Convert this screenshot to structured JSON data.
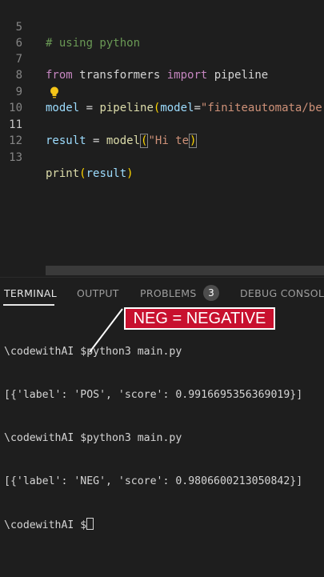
{
  "editor": {
    "lines": [
      {
        "num": "5",
        "comment": "# using python"
      },
      {
        "num": "6"
      },
      {
        "num": "7",
        "kw1": "from",
        "mod": " transformers ",
        "kw2": "import",
        "name": " pipeline"
      },
      {
        "num": "8"
      },
      {
        "num": "9",
        "var": "model",
        "eq": " = ",
        "fn": "pipeline",
        "open": "(",
        "param": "model",
        "eq2": "=",
        "str": "\"finiteautomata/bert"
      },
      {
        "num": "10"
      },
      {
        "num": "11",
        "var": "result",
        "eq": " = ",
        "fn": "model",
        "open": "(",
        "str_a": "\"Hi te",
        "close": ")"
      },
      {
        "num": "12"
      },
      {
        "num": "13",
        "fn": "print",
        "open": "(",
        "var": "result",
        "close": ")"
      }
    ]
  },
  "panel": {
    "tabs": {
      "terminal": "TERMINAL",
      "output": "OUTPUT",
      "problems": "PROBLEMS",
      "problems_count": "3",
      "debug": "DEBUG CONSOLE"
    },
    "terminal_lines": [
      "\\codewithAI $python3 main.py",
      "[{'label': 'POS', 'score': 0.9916695356369019}]",
      "\\codewithAI $python3 main.py",
      "[{'label': 'NEG', 'score': 0.9806600213050842}]",
      "\\codewithAI $"
    ]
  },
  "overlay": {
    "text": "NEG = NEGATIVE"
  }
}
